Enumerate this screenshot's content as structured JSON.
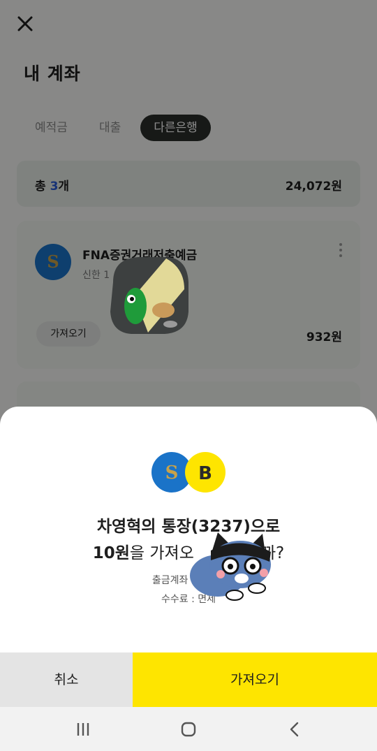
{
  "header": {
    "title": "내 계좌"
  },
  "tabs": [
    {
      "label": "예적금"
    },
    {
      "label": "대출"
    },
    {
      "label": "다른은행"
    }
  ],
  "summary": {
    "label_prefix": "총 ",
    "count": "3",
    "label_suffix": "개",
    "total": "24,072원"
  },
  "account": {
    "name": "FNA증권거래저축예금",
    "sub": "신한 1",
    "import_label": "가져오기",
    "amount": "932원"
  },
  "dialog": {
    "line1": "차영혁의 통장(3237)으로",
    "amount": "10원",
    "line2_rest": "을 가져오",
    "line2_end": "까?",
    "from": "출금계좌 : 신한 1",
    "fee": "수수료 : 면제",
    "cancel_label": "취소",
    "confirm_label": "가져오기"
  },
  "icons": {
    "close": "close-icon",
    "more": "more-vertical-icon",
    "shinhan": "shinhan-bank-logo",
    "kakao": "kakaobank-logo",
    "nav": [
      "recent-apps-icon",
      "home-icon",
      "back-icon"
    ]
  },
  "colors": {
    "accent_yellow": "#fee500",
    "count_blue": "#2a5bd7",
    "shinhan_blue": "#1a73c8"
  }
}
